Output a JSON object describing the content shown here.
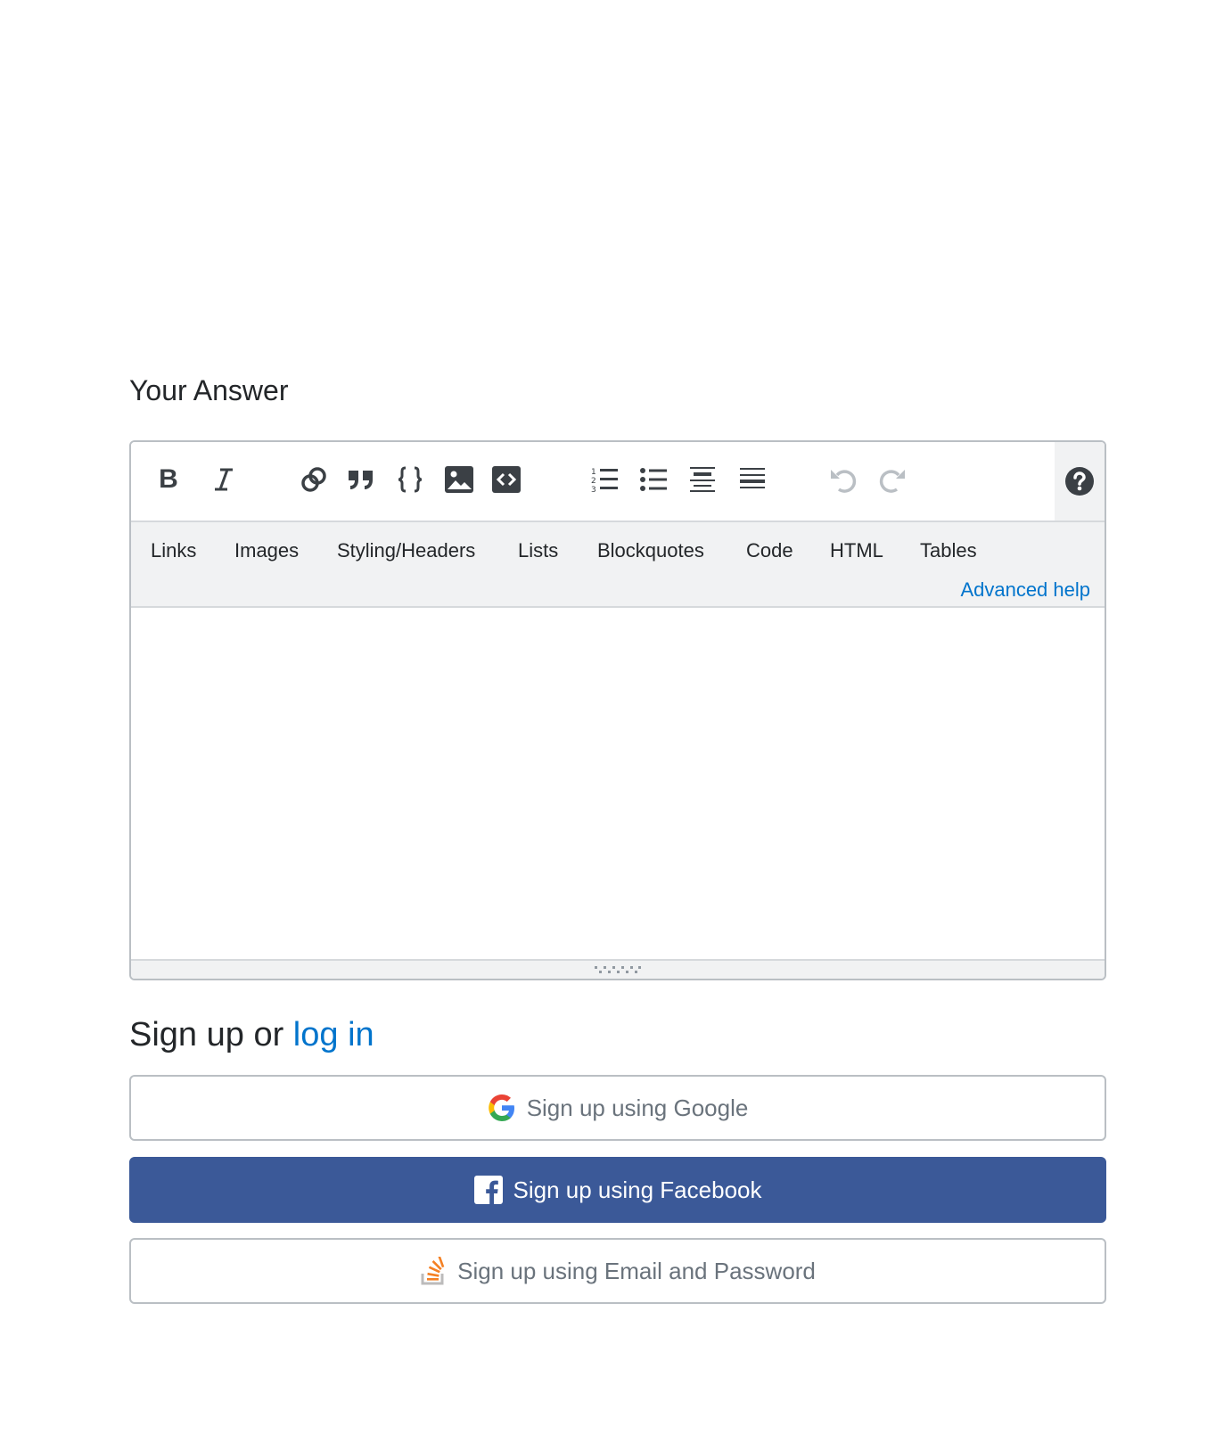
{
  "answer": {
    "title": "Your Answer"
  },
  "toolbar": {
    "bold_glyph": "B",
    "colors": {
      "icon": "#3b4045",
      "icon_disabled": "#babfc4"
    }
  },
  "help": {
    "tabs": [
      "Links",
      "Images",
      "Styling/Headers",
      "Lists",
      "Blockquotes",
      "Code",
      "HTML",
      "Tables"
    ],
    "advanced": "Advanced help"
  },
  "signup": {
    "title_prefix": "Sign up or ",
    "login_link": "log in",
    "google_label": "Sign up using Google",
    "facebook_label": "Sign up using Facebook",
    "email_label": "Sign up using Email and Password",
    "colors": {
      "facebook": "#3b5998",
      "link": "#0074cc"
    }
  }
}
